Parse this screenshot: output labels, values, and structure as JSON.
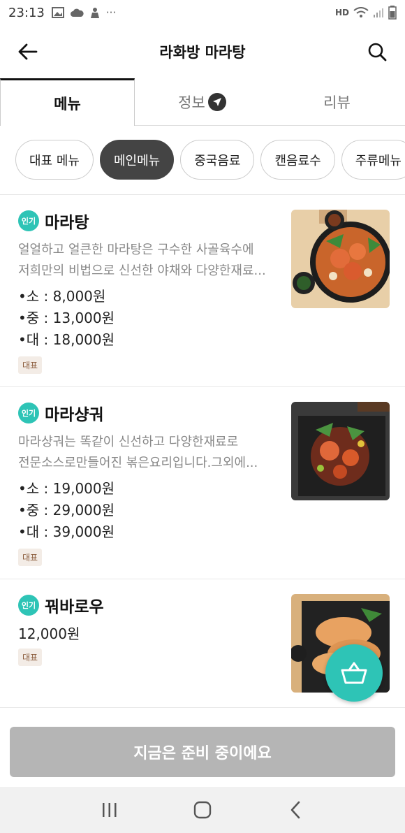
{
  "status_bar": {
    "time": "23:13",
    "icons": [
      "image-icon",
      "cloud-icon",
      "person-icon",
      "more-dots-icon"
    ],
    "more": "···",
    "hd_label": "HD"
  },
  "header": {
    "title": "라화방 마라탕"
  },
  "tabs": [
    {
      "label": "메뉴",
      "active": true
    },
    {
      "label": "정보",
      "active": false
    },
    {
      "label": "리뷰",
      "active": false
    }
  ],
  "chips": [
    {
      "label": "대표 메뉴",
      "active": false
    },
    {
      "label": "메인메뉴",
      "active": true
    },
    {
      "label": "중국음료",
      "active": false
    },
    {
      "label": "캔음료수",
      "active": false
    },
    {
      "label": "주류메뉴",
      "active": false
    }
  ],
  "menu_items": [
    {
      "badge": "인기",
      "name": "마라탕",
      "desc_line1": "얼얼하고 얼큰한 마라탕은 구수한 사골육수에",
      "desc_line2": "저희만의 비법으로 신선한 야채와 다양한재료...",
      "prices": [
        "•소 : 8,000원",
        "•중 : 13,000원",
        "•대 : 18,000원"
      ],
      "tag": "대표"
    },
    {
      "badge": "인기",
      "name": "마라샹궈",
      "desc_line1": "마라샹궈는 똑같이 신선하고 다양한재료로",
      "desc_line2": "전문소스로만들어진 볶은요리입니다.그외에...",
      "prices": [
        "•소 : 19,000원",
        "•중 : 29,000원",
        "•대 : 39,000원"
      ],
      "tag": "대표"
    },
    {
      "badge": "인기",
      "name": "꿔바로우",
      "price": "12,000원",
      "tag": "대표"
    }
  ],
  "bottom": {
    "ready_label": "지금은 준비 중이에요"
  },
  "colors": {
    "accent": "#2ec4b6",
    "chip_active": "#444444",
    "disabled_bar": "#b5b5b5"
  }
}
